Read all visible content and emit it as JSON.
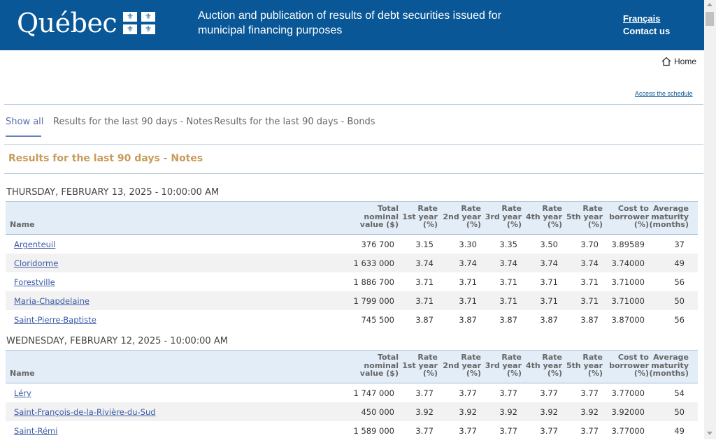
{
  "header": {
    "logo": "Québec",
    "title": "Auction and publication of results of debt securities issued for municipal financing purposes",
    "lang_link": "Français",
    "contact_link": "Contact us"
  },
  "nav": {
    "home": "Home",
    "schedule": "Access the schedule"
  },
  "tabs": [
    {
      "label": "Show all",
      "active": true
    },
    {
      "label": "Results for the last 90 days - Notes",
      "active": false
    },
    {
      "label": "Results for the last 90 days - Bonds",
      "active": false
    }
  ],
  "section_title": "Results for the last 90 days - Notes",
  "columns": {
    "name": "Name",
    "total": [
      "Total",
      "nominal",
      "value ($)"
    ],
    "r1": [
      "Rate",
      "1st year",
      "(%)"
    ],
    "r2": [
      "Rate",
      "2nd year",
      "(%)"
    ],
    "r3": [
      "Rate",
      "3rd year",
      "(%)"
    ],
    "r4": [
      "Rate",
      "4th year",
      "(%)"
    ],
    "r5": [
      "Rate",
      "5th year",
      "(%)"
    ],
    "cost": [
      "Cost to",
      "borrower",
      "(%)"
    ],
    "avg": [
      "Average",
      "maturity",
      "(months)"
    ]
  },
  "groups": [
    {
      "date": "THURSDAY, FEBRUARY 13, 2025 - 10:00:00 AM",
      "rows": [
        [
          "Argenteuil",
          "376 700",
          "3.15",
          "3.30",
          "3.35",
          "3.50",
          "3.70",
          "3.89589",
          "37"
        ],
        [
          "Cloridorme",
          "1 633 000",
          "3.74",
          "3.74",
          "3.74",
          "3.74",
          "3.74",
          "3.74000",
          "49"
        ],
        [
          "Forestville",
          "1 886 700",
          "3.71",
          "3.71",
          "3.71",
          "3.71",
          "3.71",
          "3.71000",
          "56"
        ],
        [
          "Maria-Chapdelaine",
          "1 799 000",
          "3.71",
          "3.71",
          "3.71",
          "3.71",
          "3.71",
          "3.71000",
          "50"
        ],
        [
          "Saint-Pierre-Baptiste",
          "745 500",
          "3.87",
          "3.87",
          "3.87",
          "3.87",
          "3.87",
          "3.87000",
          "56"
        ]
      ]
    },
    {
      "date": "WEDNESDAY, FEBRUARY 12, 2025 - 10:00:00 AM",
      "rows": [
        [
          "Léry",
          "1 747 000",
          "3.77",
          "3.77",
          "3.77",
          "3.77",
          "3.77",
          "3.77000",
          "54"
        ],
        [
          "Saint-François-de-la-Rivière-du-Sud",
          "450 000",
          "3.92",
          "3.92",
          "3.92",
          "3.92",
          "3.92",
          "3.92000",
          "50"
        ],
        [
          "Saint-Rémi",
          "1 589 000",
          "3.77",
          "3.77",
          "3.77",
          "3.77",
          "3.77",
          "3.77000",
          "49"
        ]
      ]
    }
  ],
  "colors": {
    "header_bg": "#095797",
    "section_title": "#c89b5a",
    "link": "#3b5ba7",
    "table_header_bg": "#e3edf7"
  }
}
